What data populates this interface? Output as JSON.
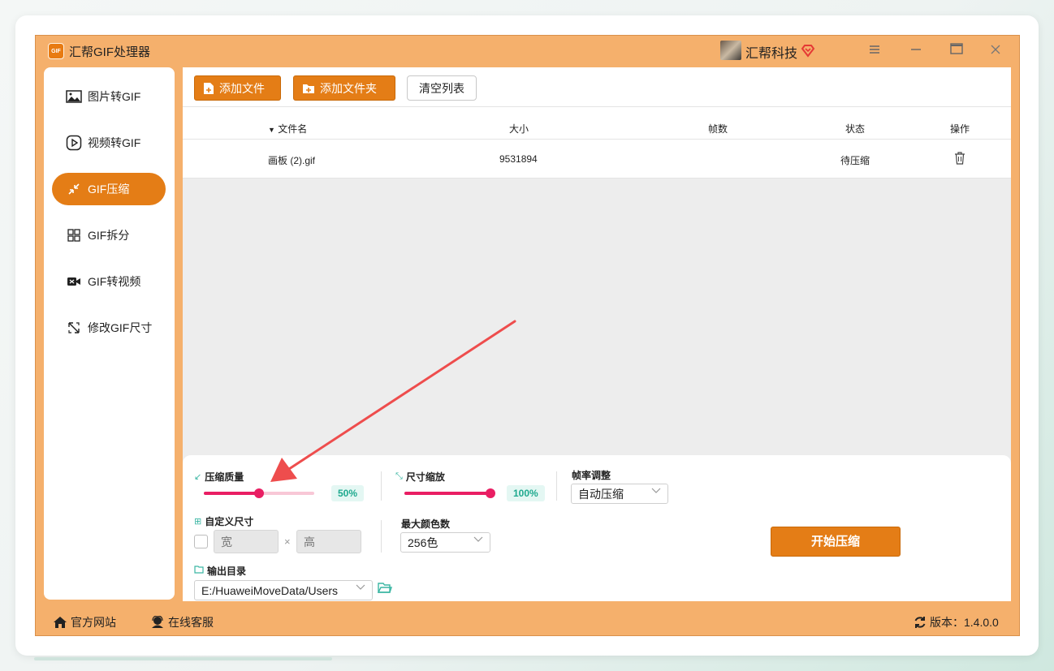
{
  "app": {
    "title": "汇帮GIF处理器",
    "logo_text": "GIF",
    "user_name": "汇帮科技"
  },
  "sidebar": {
    "items": [
      {
        "label": "图片转GIF",
        "icon": "image-icon"
      },
      {
        "label": "视频转GIF",
        "icon": "play-icon"
      },
      {
        "label": "GIF压缩",
        "icon": "compress-icon"
      },
      {
        "label": "GIF拆分",
        "icon": "split-icon"
      },
      {
        "label": "GIF转视频",
        "icon": "video-icon"
      },
      {
        "label": "修改GIF尺寸",
        "icon": "resize-icon"
      }
    ],
    "active": "GIF压缩"
  },
  "toolbar": {
    "add_file": "添加文件",
    "add_folder": "添加文件夹",
    "clear_list": "清空列表"
  },
  "table": {
    "headers": {
      "name": "文件名",
      "size": "大小",
      "frames": "帧数",
      "status": "状态",
      "action": "操作"
    },
    "rows": [
      {
        "name": "画板 (2).gif",
        "size": "9531894",
        "frames": "",
        "status": "待压缩"
      }
    ]
  },
  "settings": {
    "quality": {
      "label": "压缩质量",
      "value": "50%",
      "fraction": 0.5
    },
    "scale": {
      "label": "尺寸缩放",
      "value": "100%",
      "fraction": 1.0
    },
    "framerate": {
      "label": "帧率调整",
      "selected": "自动压缩"
    },
    "custom_size": {
      "label": "自定义尺寸",
      "width_placeholder": "宽",
      "height_placeholder": "高",
      "times": "×"
    },
    "max_colors": {
      "label": "最大颜色数",
      "selected": "256色"
    },
    "output": {
      "label": "输出目录",
      "path": "E:/HuaweiMoveData/Users"
    },
    "start_button": "开始压缩"
  },
  "footer": {
    "website": "官方网站",
    "support": "在线客服",
    "version": "版本：1.4.0.0"
  },
  "colors": {
    "window_bg": "#f5b06c",
    "accent": "#e47d16",
    "slider": "#e91e63",
    "badge_text": "#1ea98e"
  }
}
